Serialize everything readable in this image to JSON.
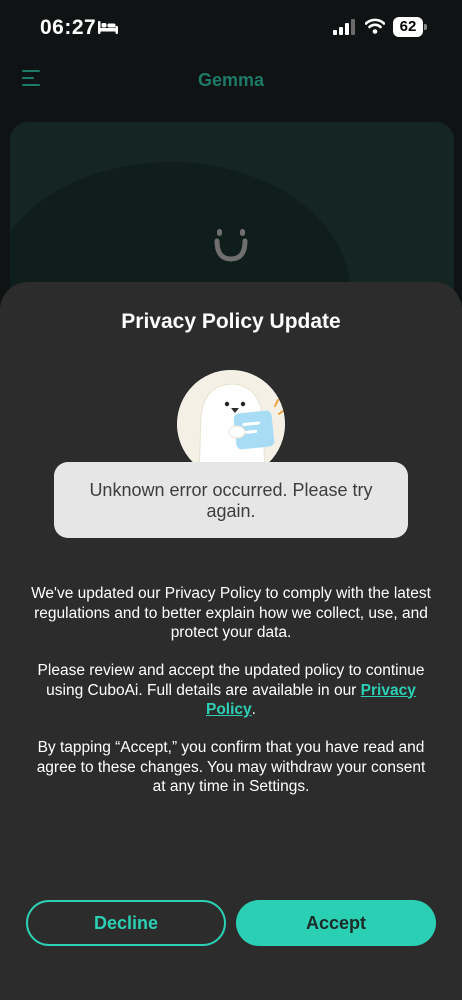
{
  "status_bar": {
    "time": "06:27",
    "battery": "62"
  },
  "header": {
    "title": "Gemma"
  },
  "modal": {
    "title": "Privacy Policy Update",
    "paragraph1": "We've updated our Privacy Policy to comply with the latest regulations and to better explain how we collect, use, and protect your data.",
    "paragraph2_prefix": "Please review and accept the updated policy to continue using CuboAi. Full details are available in our ",
    "paragraph2_link": "Privacy Policy",
    "paragraph2_suffix": ".",
    "paragraph3": "By tapping “Accept,” you confirm that you have read and agree to these changes. You may withdraw your consent at any time in Settings.",
    "decline_label": "Decline",
    "accept_label": "Accept"
  },
  "toast": {
    "message": "Unknown error occurred. Please try again."
  },
  "colors": {
    "accent": "#2bd0b4",
    "sheet_background": "#2c2c2c",
    "toast_background": "#e6e6e6"
  },
  "icons": [
    "bed-icon",
    "cellular-signal-icon",
    "wifi-icon",
    "battery-icon",
    "menu-icon",
    "cuboai-logo-icon"
  ]
}
